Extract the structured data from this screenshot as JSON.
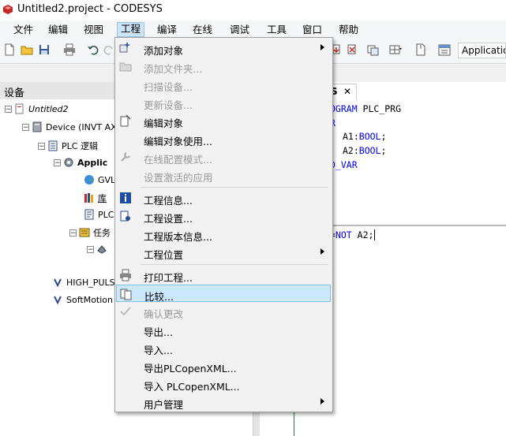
{
  "window": {
    "title": "Untitled2.project - CODESYS"
  },
  "menubar": {
    "items": [
      {
        "label": "文件"
      },
      {
        "label": "编辑"
      },
      {
        "label": "视图"
      },
      {
        "label": "工程"
      },
      {
        "label": "编译"
      },
      {
        "label": "在线"
      },
      {
        "label": "调试"
      },
      {
        "label": "工具"
      },
      {
        "label": "窗口"
      },
      {
        "label": "帮助"
      }
    ]
  },
  "toolbar": {
    "active_app_label": "Applicatio"
  },
  "device_panel": {
    "title": "设备",
    "tree": [
      {
        "label": "Untitled2"
      },
      {
        "label": "Device (INVT AX"
      },
      {
        "label": "PLC 逻辑"
      },
      {
        "label": "Applic"
      },
      {
        "label": "GVL"
      },
      {
        "label": "库"
      },
      {
        "label": "PLC"
      },
      {
        "label": "任务"
      },
      {
        "label": ""
      },
      {
        "label": "HIGH_PULS"
      },
      {
        "label": "SoftMotion"
      }
    ]
  },
  "editor": {
    "tab_label": "S",
    "tab_close": "✕",
    "lines": [
      {
        "kw": "OGRAM",
        "rest": " PLC_PRG"
      },
      {
        "kw": "R",
        "rest": ""
      },
      {
        "kw": "",
        "rest": "A1:",
        "type": "BOOL",
        "tail": ";"
      },
      {
        "kw": "",
        "rest": "A2:",
        "type": "BOOL",
        "tail": ";"
      },
      {
        "kw": "D_VAR",
        "rest": ""
      }
    ],
    "body_line": {
      "pre": "=",
      "kw": "NOT",
      "post": " A2;"
    }
  },
  "dropdown": {
    "items": [
      {
        "label": "添加对象",
        "enabled": true,
        "submenu": true
      },
      {
        "label": "添加文件夹...",
        "enabled": false
      },
      {
        "label": "扫描设备...",
        "enabled": false
      },
      {
        "label": "更新设备...",
        "enabled": false
      },
      {
        "label": "编辑对象",
        "enabled": true
      },
      {
        "label": "编辑对象使用...",
        "enabled": true
      },
      {
        "label": "在线配置模式...",
        "enabled": false
      },
      {
        "label": "设置激活的应用",
        "enabled": false
      },
      {
        "label": "工程信息...",
        "enabled": true
      },
      {
        "label": "工程设置...",
        "enabled": true
      },
      {
        "label": "工程版本信息...",
        "enabled": true
      },
      {
        "label": "工程位置",
        "enabled": true,
        "submenu": true
      },
      {
        "label": "打印工程...",
        "enabled": true
      },
      {
        "label": "比较...",
        "enabled": true,
        "highlighted": true
      },
      {
        "label": "确认更改",
        "enabled": false
      },
      {
        "label": "导出...",
        "enabled": true
      },
      {
        "label": "导入...",
        "enabled": true
      },
      {
        "label": "导出PLCopenXML...",
        "enabled": true
      },
      {
        "label": "导入 PLCopenXML...",
        "enabled": true
      },
      {
        "label": "用户管理",
        "enabled": true,
        "submenu": true
      }
    ]
  },
  "colors": {
    "highlight": "#cce8ff",
    "keyword": "#0000ff",
    "disabled": "#9a9a9a"
  }
}
